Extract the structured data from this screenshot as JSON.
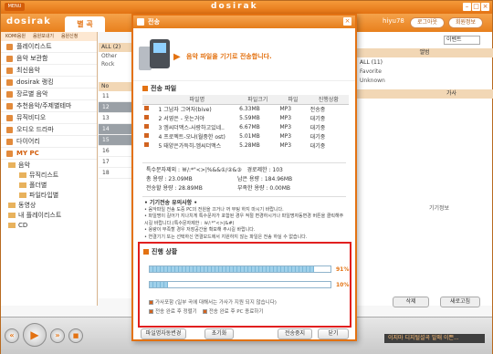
{
  "window": {
    "menu_label": "MENU",
    "title": "dosirak",
    "min": "–",
    "max": "□",
    "close": "×"
  },
  "header": {
    "logo": "dosirak",
    "tab": "별 곡",
    "user": "hiyu78",
    "btn_login": "로그아웃",
    "btn_member": "회원정보",
    "search_placeholder": "이벤트"
  },
  "sidebar": {
    "subtabs": [
      "KOMI음원",
      "음원보내기",
      "음원신청"
    ],
    "items": [
      "플레이리스트",
      "음악 보관함",
      "최신음악",
      "dosirak 랭킹",
      "장르별 음악",
      "추천음악/주제별테마",
      "뮤직비디오",
      "오디오 드라마",
      "다이어리"
    ],
    "mypc": "MY PC",
    "tree": [
      "음악",
      "뮤직리스트",
      "폴더별",
      "파일타입별",
      "동영상",
      "내 플레이리스트",
      "CD"
    ]
  },
  "midlist": {
    "all": "ALL (2)",
    "items": [
      "Other",
      "Rock"
    ],
    "col": "No",
    "nums": [
      "11",
      "12",
      "13",
      "14",
      "15",
      "16",
      "17",
      "18"
    ]
  },
  "right": {
    "col_title": "앨범",
    "all": "ALL (11)",
    "items": [
      "Favorite",
      "Unknown"
    ],
    "col_lyrics": "가사",
    "more": "기기정보",
    "btn_delete": "삭제",
    "btn_refresh": "새로고침"
  },
  "player": {
    "status": "이지마 디지털설곡 발매 이쁜..."
  },
  "dialog": {
    "title": "전송",
    "banner": "음악 파일을 기기로 전송합니다.",
    "section_files": "전송 파일",
    "columns": [
      "",
      "파일명",
      "파일크기",
      "파일",
      "진행상황"
    ],
    "files": [
      {
        "no": "1",
        "name": "그남자 그여자(bive)",
        "size": "6.33MB",
        "type": "MP3",
        "status": "전송중"
      },
      {
        "no": "2",
        "name": "서영은 - 웃는거야",
        "size": "5.59MB",
        "type": "MP3",
        "status": "대기중"
      },
      {
        "no": "3",
        "name": "엠씨더맥스-사랑하고있네..",
        "size": "6.67MB",
        "type": "MP3",
        "status": "대기중"
      },
      {
        "no": "4",
        "name": "프로젝트-오냐(월중한 ost)",
        "size": "5.01MB",
        "type": "MP3",
        "status": "대기중"
      },
      {
        "no": "5",
        "name": "태양은가득히-엠씨더맥스",
        "size": "5.28MB",
        "type": "MP3",
        "status": "대기중"
      }
    ],
    "stats": {
      "special_label": "특수문자제외 : ",
      "special_value": "￦/:*\"<>|%&&①/②&③",
      "path_label": "경로제한 : 103",
      "total_label": "총  용량 :",
      "total_value": "23.09MB",
      "remain_label": "남은 용량 :",
      "remain_value": "184.96MB",
      "transfer_label": "전송할 용량 :",
      "transfer_value": "28.89MB",
      "short_label": "부족한 용량 :",
      "short_value": "0.00MB"
    },
    "notice_title": "• 기기전송 유의사항 •",
    "notice_lines": [
      "• 음악파일 전송 도중 PC의 전원을 끄거나 꺼 부팅 하지 마시기 바랍니다.",
      "• 파일명이 길어가 지나치게 특수문자가 포함된 경우 적절 변경하시거나 파일명자동변경 버튼을 클릭해주시길 바랍니다.(특수문자제한 : ￦/:*\"<>|&#)",
      "• 용량이 부족할 경우 저장공간을 확보해 주시길 바랍니다.",
      "• 연결기기 또는 선택하신 연결모드에서 지원하지 않는 파일은 전송 하실 수 없습니다."
    ],
    "progress_title": "진행 상황",
    "progress": [
      {
        "value": 91,
        "label": "91%"
      },
      {
        "value": 10,
        "label": "10%"
      }
    ],
    "legend": [
      "가사포함 (일부 곡에 대해서는 가사가 지원 되지 않습니다)",
      "전송 완료 후 정렬기",
      "전송 완료 후 PC 종료하기"
    ],
    "btn_rename": "파일명자동변경",
    "btn_reset": "초기화",
    "btn_stop": "전송중지",
    "btn_close": "닫기"
  }
}
